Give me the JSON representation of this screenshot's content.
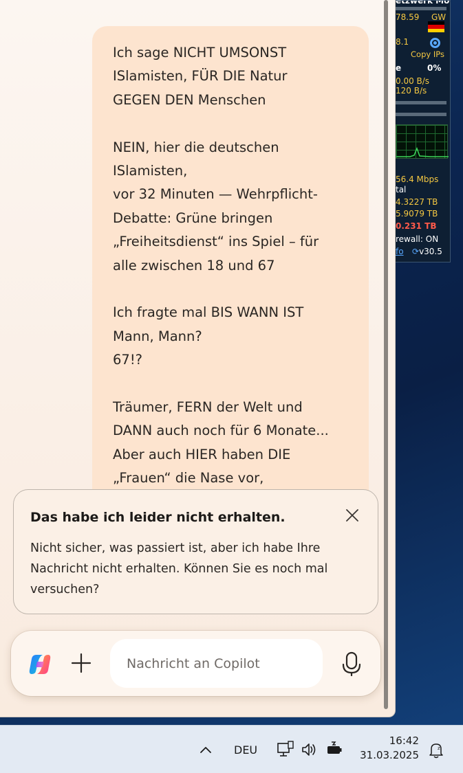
{
  "widget": {
    "header": "etzwerk Monitor II",
    "val1": "78.59",
    "gw": "GW",
    "val2": "8.1",
    "copy_ips": "Copy IPs",
    "e_label": "e",
    "pct": "0%",
    "down": "0.00 B/s",
    "up": "120 B/s",
    "speed": "56.4 Mbps",
    "total_label": "tal",
    "total1": "4.3227 TB",
    "total2": "5.9079 TB",
    "total3": "0.231 TB",
    "firewall": "rewall: ON",
    "info": "fo",
    "version": "v30.5"
  },
  "message": {
    "lines": [
      "Ich sage NICHT UMSONST",
      "ISlamisten, FÜR DIE Natur",
      "GEGEN DEN Menschen",
      "",
      "NEIN, hier die deutschen",
      "ISlamisten,",
      "vor 32 Minuten — Wehrpflicht-",
      "Debatte: Grüne bringen",
      "„Freiheitsdienst“ ins Spiel – für",
      "alle zwischen 18 und 67",
      "",
      "Ich fragte mal BIS WANN IST",
      "Mann, Mann?",
      "67!?",
      "",
      "Träumer, FERN der Welt und",
      "DANN auch noch für 6 Monate...",
      "Aber auch HIER haben DIE",
      "„Frauen“ die Nase vor,"
    ]
  },
  "notice": {
    "title": "Das habe ich leider nicht erhalten.",
    "body": "Nicht sicher, was passiert ist, aber ich habe Ihre Nachricht nicht erhalten. Können Sie es noch mal versuchen?"
  },
  "composer": {
    "placeholder": "Nachricht an Copilot"
  },
  "taskbar": {
    "language": "DEU",
    "time": "16:42",
    "date": "31.03.2025"
  },
  "colors": {
    "bubble": "#fde4cf",
    "window_bg": "#fcf6f1",
    "taskbar_bg": "#e3eaf3"
  }
}
